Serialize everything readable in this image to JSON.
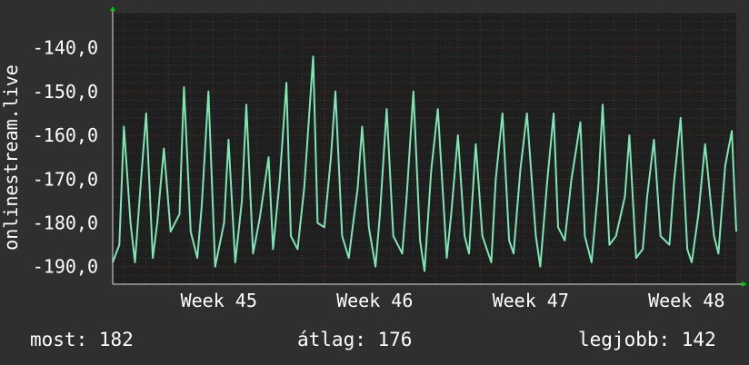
{
  "chart_data": {
    "type": "line",
    "ylabel": "onlinestream.live",
    "ylim": [
      -194,
      -132
    ],
    "y_ticks": [
      -140,
      -150,
      -160,
      -170,
      -180,
      -190
    ],
    "y_tick_labels": [
      "-140,0",
      "-150,0",
      "-160,0",
      "-170,0",
      "-180,0",
      "-190,0"
    ],
    "x_range": [
      0,
      28
    ],
    "x_ticks": [
      {
        "x": 5.5,
        "label": "Week 45"
      },
      {
        "x": 12.5,
        "label": "Week 46"
      },
      {
        "x": 19.5,
        "label": "Week 47"
      },
      {
        "x": 26.5,
        "label": "Week 48"
      }
    ],
    "grid": true,
    "series": [
      {
        "color": "#7de6b4",
        "x": [
          0,
          0.3,
          0.5,
          0.8,
          1.0,
          1.2,
          1.5,
          1.8,
          2.0,
          2.3,
          2.6,
          3.0,
          3.2,
          3.5,
          3.8,
          4.0,
          4.3,
          4.6,
          5.0,
          5.2,
          5.5,
          5.8,
          6.0,
          6.3,
          6.6,
          7.0,
          7.2,
          7.5,
          7.8,
          8.0,
          8.3,
          8.6,
          9.0,
          9.2,
          9.5,
          9.8,
          10.0,
          10.3,
          10.6,
          11.0,
          11.2,
          11.5,
          11.8,
          12.0,
          12.3,
          12.6,
          13.0,
          13.2,
          13.5,
          13.8,
          14.0,
          14.3,
          14.6,
          15.0,
          15.2,
          15.5,
          15.8,
          16.0,
          16.3,
          16.6,
          17.0,
          17.2,
          17.5,
          17.8,
          18.0,
          18.3,
          18.6,
          19.0,
          19.2,
          19.5,
          19.8,
          20.0,
          20.3,
          20.6,
          21.0,
          21.2,
          21.5,
          21.8,
          22.0,
          22.3,
          22.6,
          23.0,
          23.2,
          23.5,
          23.8,
          24.0,
          24.3,
          24.6,
          25.0,
          25.2,
          25.5,
          25.8,
          26.0,
          26.3,
          26.6,
          27.0,
          27.2,
          27.5,
          27.8,
          28.0
        ],
        "values": [
          -189,
          -185,
          -158,
          -180,
          -189,
          -175,
          -155,
          -188,
          -180,
          -163,
          -182,
          -178,
          -149,
          -182,
          -188,
          -176,
          -150,
          -190,
          -180,
          -161,
          -189,
          -175,
          -153,
          -187,
          -179,
          -165,
          -186,
          -170,
          -148,
          -183,
          -186,
          -172,
          -142,
          -180,
          -181,
          -165,
          -150,
          -183,
          -188,
          -172,
          -158,
          -181,
          -190,
          -178,
          -154,
          -183,
          -187,
          -174,
          -150,
          -184,
          -191,
          -168,
          -154,
          -188,
          -178,
          -160,
          -183,
          -187,
          -162,
          -183,
          -189,
          -170,
          -155,
          -184,
          -187,
          -168,
          -155,
          -183,
          -190,
          -171,
          -155,
          -181,
          -184,
          -170,
          -157,
          -183,
          -189,
          -172,
          -153,
          -185,
          -183,
          -174,
          -160,
          -188,
          -186,
          -174,
          -161,
          -183,
          -185,
          -171,
          -156,
          -186,
          -189,
          -178,
          -162,
          -183,
          -187,
          -167,
          -159,
          -182
        ]
      }
    ]
  },
  "stats": {
    "now": "most: 182",
    "avg": "átlag: 176",
    "best": "legjobb: 142"
  },
  "colors": {
    "background": "#2f2f2f",
    "plot_background": "#1f1f1f",
    "line": "#7de6b4",
    "grid_major": "#6a2a2a",
    "grid_minor": "#3a3a3a",
    "text": "#ffffff",
    "axis_arrow": "#00cc00"
  }
}
